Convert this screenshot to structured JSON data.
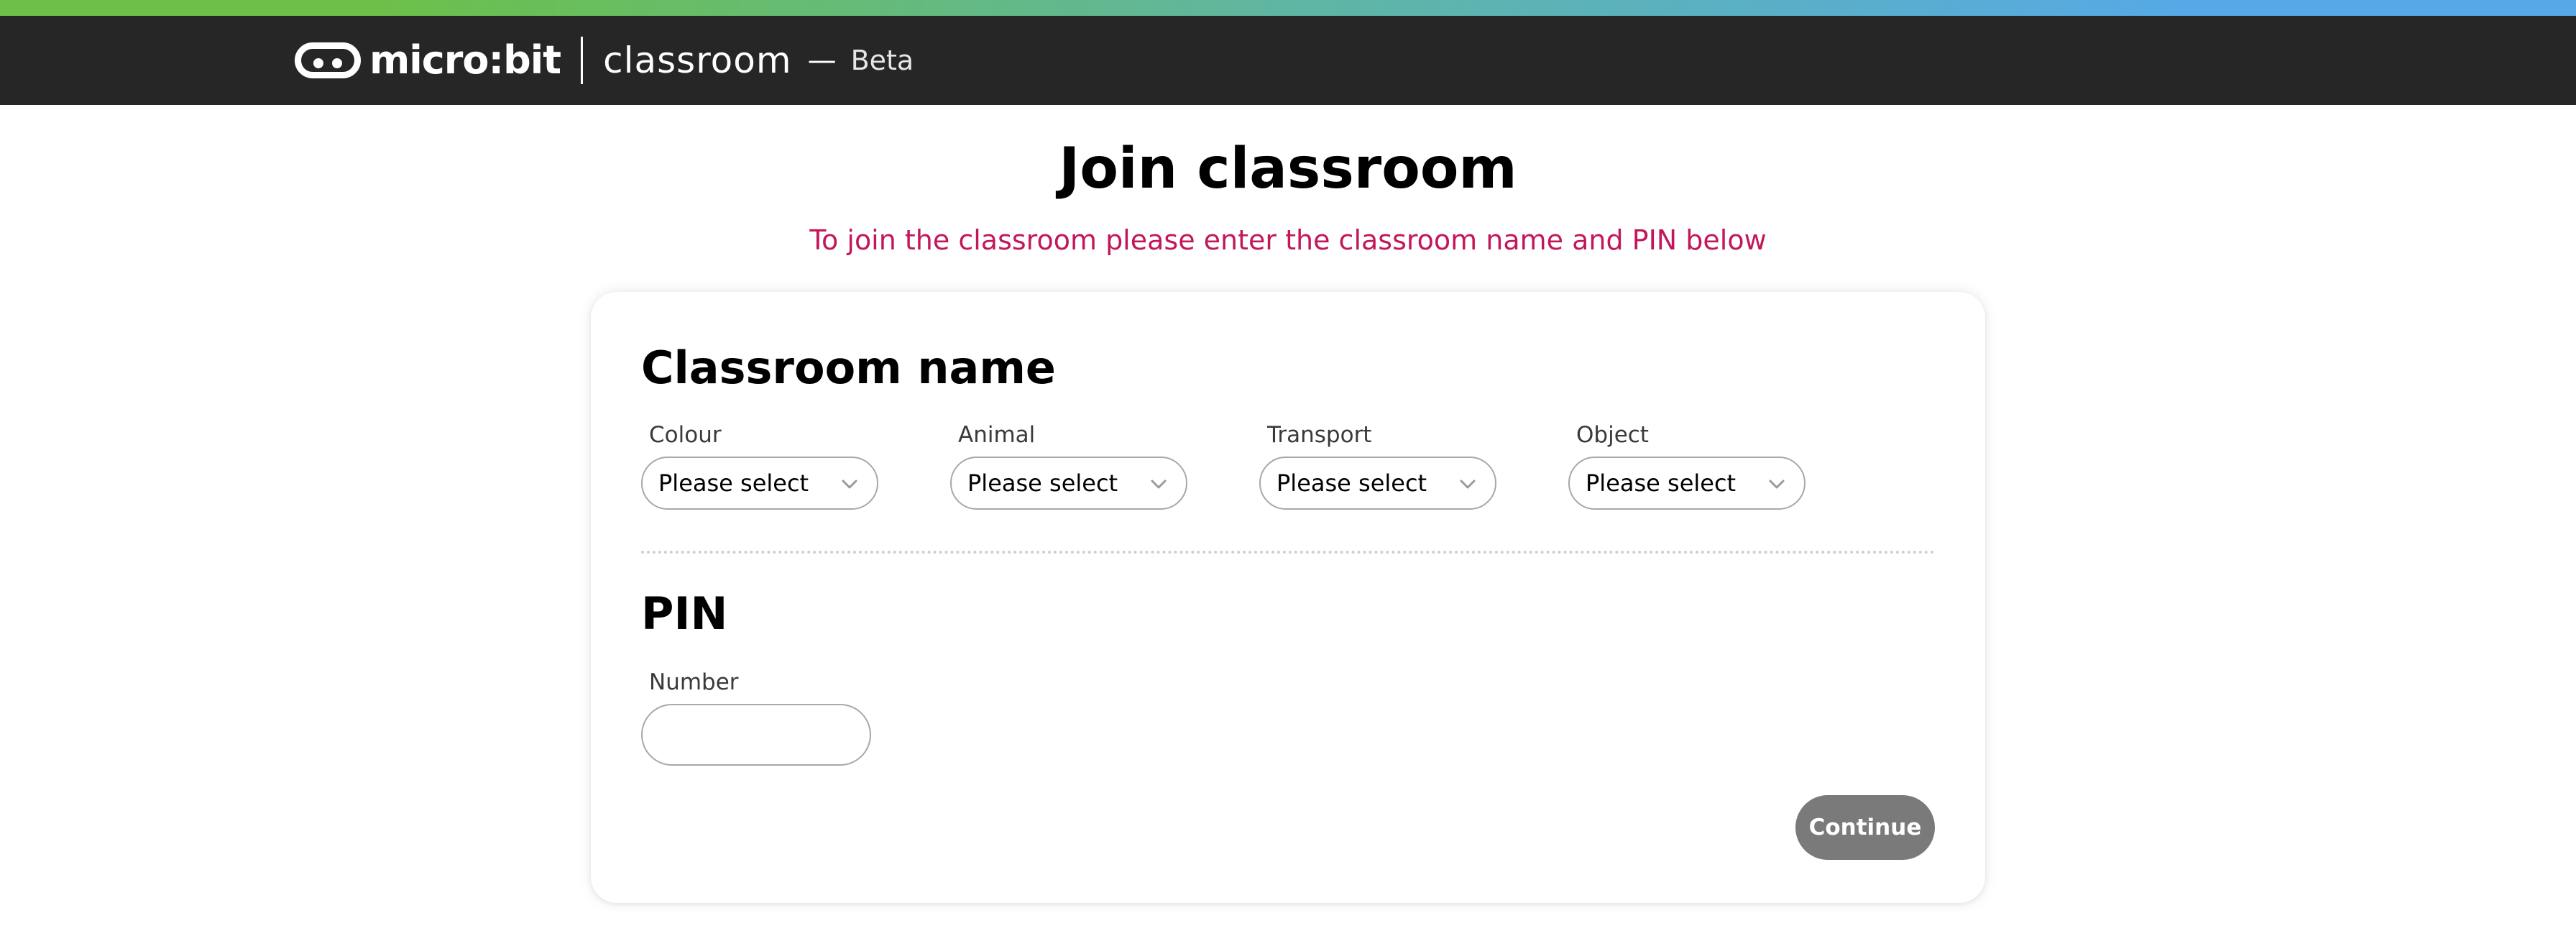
{
  "header": {
    "logo_text": "micro:bit",
    "product": "classroom",
    "separator": "—",
    "badge": "Beta"
  },
  "page": {
    "title": "Join classroom",
    "subtitle": "To join the classroom please enter the classroom name and PIN below"
  },
  "classroom_name": {
    "heading": "Classroom name",
    "fields": [
      {
        "label": "Colour",
        "value": "Please select"
      },
      {
        "label": "Animal",
        "value": "Please select"
      },
      {
        "label": "Transport",
        "value": "Please select"
      },
      {
        "label": "Object",
        "value": "Please select"
      }
    ]
  },
  "pin": {
    "heading": "PIN",
    "number_label": "Number",
    "number_value": ""
  },
  "actions": {
    "continue_label": "Continue"
  },
  "colors": {
    "header_bg": "#262626",
    "subtitle": "#c2185b",
    "continue_disabled": "#7a7a7a",
    "stripe_left": "#6cc04a",
    "stripe_right": "#56a9e6"
  },
  "icons": {
    "logo": "microbit-logo-icon",
    "dropdown": "chevron-down-icon"
  }
}
